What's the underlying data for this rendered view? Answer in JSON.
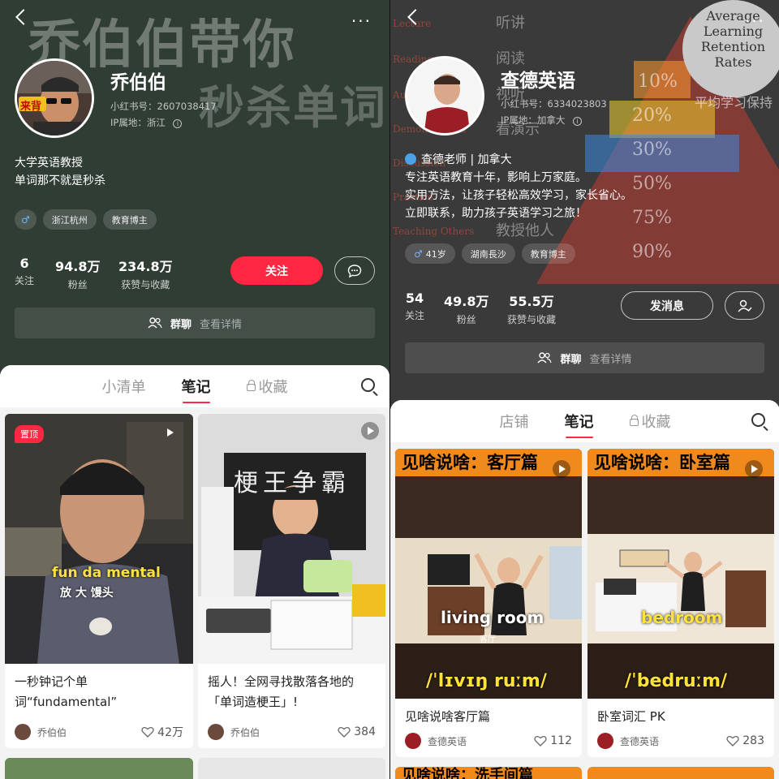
{
  "left": {
    "bg_text_1": "乔伯伯带你",
    "bg_text_2": "秒杀单词",
    "profile": {
      "name": "乔伯伯",
      "account_id": "小红书号：2607038417",
      "ip": "IP属地：浙江",
      "avatar_badge": "来背",
      "bio_line1": "大学英语教授",
      "bio_line2": "单词那不就是秒杀",
      "tags": [
        "浙江杭州",
        "教育博主"
      ],
      "stats": [
        {
          "num": "6",
          "label": "关注"
        },
        {
          "num": "94.8万",
          "label": "粉丝"
        },
        {
          "num": "234.8万",
          "label": "获赞与收藏"
        }
      ],
      "follow_label": "关注",
      "group_title": "群聊",
      "group_detail": "查看详情"
    },
    "tabs": [
      "小清单",
      "笔记",
      "收藏"
    ],
    "active_tab": "笔记",
    "cards": [
      {
        "pin": "置顶",
        "caption_en": "fun da mental",
        "caption_cn": "放 大 馒头",
        "title": "一秒钟记个单词“fundamental”",
        "author": "乔伯伯",
        "likes": "42万"
      },
      {
        "board_text": "梗王争霸",
        "title": "摇人！全网寻找散落各地的「单词造梗王」!",
        "author": "乔伯伯",
        "likes": "384"
      }
    ]
  },
  "right": {
    "bg": {
      "seal_lines": [
        "Average",
        "Learning",
        "Retention",
        "Rates"
      ],
      "cn_caption": "平均学习保持",
      "side_words": [
        "Lecture",
        "Reading",
        "Audio",
        "Demonstration",
        "Discussion",
        "Practice",
        "Teaching Others"
      ],
      "pyramid_pcts": [
        "10%",
        "20%",
        "30%",
        "50%",
        "75%",
        "90%"
      ],
      "pyramid_cn": [
        "听讲",
        "阅读",
        "视听",
        "看演示",
        "教授他人"
      ]
    },
    "profile": {
      "name": "查德英语",
      "account_id": "小红书号：6334023803",
      "ip": "IP属地：加拿大",
      "bio_line1": "查德老师 | 加拿大",
      "bio_line2": "专注英语教育十年，影响上万家庭。",
      "bio_line3": "实用方法，让孩子轻松高效学习，家长省心。",
      "bio_line4": "立即联系，助力孩子英语学习之旅！",
      "age_tag": "41岁",
      "tags": [
        "湖南長沙",
        "教育博主"
      ],
      "stats": [
        {
          "num": "54",
          "label": "关注"
        },
        {
          "num": "49.8万",
          "label": "粉丝"
        },
        {
          "num": "55.5万",
          "label": "获赞与收藏"
        }
      ],
      "message_label": "发消息",
      "group_title": "群聊",
      "group_detail": "查看详情"
    },
    "tabs": [
      "店铺",
      "笔记",
      "收藏"
    ],
    "active_tab": "笔记",
    "cards": [
      {
        "banner": "见啥说啥：客厅篇",
        "caption_en": "living room",
        "caption_cn": "客厅",
        "phonetic": "/ˈlɪvɪŋ ruːm/",
        "title": "见啥说啥客厅篇",
        "author": "查德英语",
        "likes": "112"
      },
      {
        "banner": "见啥说啥：卧室篇",
        "caption_en": "bedroom",
        "phonetic": "/ˈbedruːm/",
        "title": "卧室词汇 PK",
        "author": "查德英语",
        "likes": "283"
      }
    ],
    "next_banner": "见啥说啥：洗手间篇"
  },
  "colors": {
    "accent": "#ff2741",
    "left_bg": "#2f3d33",
    "right_bg": "#3a3a3a",
    "banner": "#f08a1c",
    "caption_yellow": "#ffe23a"
  }
}
